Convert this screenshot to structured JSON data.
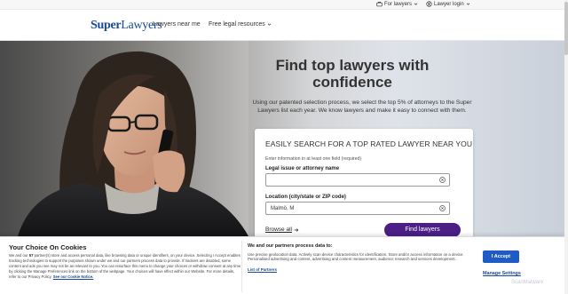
{
  "utility": {
    "for_lawyers": "For lawyers",
    "lawyer_login": "Lawyer login"
  },
  "nav": {
    "logo": {
      "super": "Super",
      "lawyers": "Lawyers"
    },
    "lawyers_near_me": "Lawyers near me",
    "free_legal_resources": "Free legal resources"
  },
  "hero": {
    "title": "Find top lawyers with confidence",
    "subtitle": "Using our patented selection process, we select the top 5% of attorneys to the Super Lawyers list each year. We know lawyers and make it easy to connect with them."
  },
  "search": {
    "heading": "EASILY SEARCH FOR A TOP RATED LAWYER NEAR YOU",
    "note": "Enter information in at least one field (required)",
    "issue_label": "Legal issue or attorney name",
    "issue_value": "",
    "location_label": "Location (city/state or ZIP code)",
    "location_value": "Malmö, M",
    "browse_all": "Browse all",
    "find_button": "Find lawyers"
  },
  "cookie": {
    "title": "Your Choice On Cookies",
    "body_start": "We and our",
    "partner_count": "57",
    "body_rest": "partner(s) store and access personal data, like browsing data or unique identifiers, on your device. Selecting I Accept enables tracking technologies to support the purposes shown under we and our partners process data to provide. If trackers are disabled, some content and ads you see may not be as relevant to you. You can resurface this menu to change your choices or withdraw consent at any time by clicking the Manage Preferences link on the bottom of the webpage. Your choices will have effect within our Website. For more details, refer to our Privacy Policy.",
    "notice_link": "See our Cookie Notice.",
    "partners_title": "We and our partners process data to:",
    "partners_body": "Use precise geolocation data. Actively scan device characteristics for identification. Store and/or access information on a device. Personalised advertising and content, advertising and content measurement, audience research and services development.",
    "list_of_partners": "List of Partners",
    "accept_button": "I Accept",
    "manage_settings": "Manage Settings",
    "watermark": "ScanMalware"
  },
  "colors": {
    "brand_blue": "#1a4a96",
    "find_button": "#4b1f86",
    "accept_button": "#1f5bc4"
  },
  "icons": [
    "briefcase-icon",
    "user-circle-icon",
    "chevron-down-icon",
    "clear-icon",
    "arrow-right-icon"
  ]
}
